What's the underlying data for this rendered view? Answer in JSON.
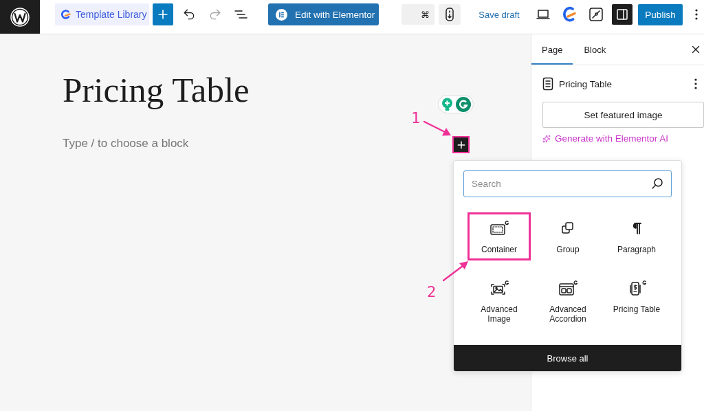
{
  "toolbar": {
    "template_library": {
      "label": "Template Library"
    },
    "history": [
      {
        "kind": "undo",
        "disabled": false
      },
      {
        "kind": "redo",
        "disabled": true
      }
    ],
    "edit_button": {
      "label": "Edit with Elementor"
    },
    "shortcut": {
      "label": "⌘"
    },
    "save_draft": {
      "label": "Save draft"
    },
    "sidebar_toggle": {
      "pressed": true
    },
    "publish": {
      "label": "Publish"
    }
  },
  "canvas": {
    "title": "Pricing Table",
    "placeholder": "Type / to choose a block"
  },
  "annotations": [
    {
      "label": "1"
    },
    {
      "label": "2"
    }
  ],
  "inserter": {
    "search": {
      "placeholder": "Search"
    },
    "blocks": [
      {
        "kind": "container",
        "label": "Container",
        "highlighted": true
      },
      {
        "kind": "group",
        "label": "Group",
        "highlighted": false
      },
      {
        "kind": "paragraph",
        "label": "Paragraph",
        "highlighted": false
      },
      {
        "kind": "image",
        "label": "Advanced Image",
        "highlighted": false
      },
      {
        "kind": "accordion",
        "label": "Advanced Accordion",
        "highlighted": false
      },
      {
        "kind": "pricing",
        "label": "Pricing Table",
        "highlighted": false
      }
    ],
    "browse_all": "Browse all"
  },
  "sidebar": {
    "tabs": [
      {
        "label": "Page",
        "selected": true
      },
      {
        "label": "Block",
        "selected": false
      }
    ],
    "document": {
      "title": "Pricing Table"
    },
    "featured_image_button": "Set featured image",
    "ai_link": "Generate with Elementor AI"
  }
}
